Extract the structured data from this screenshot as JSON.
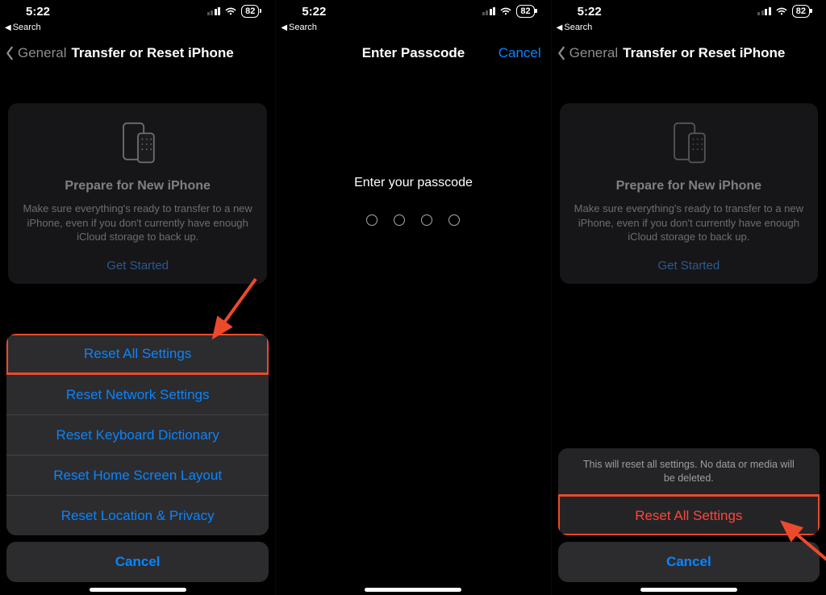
{
  "status": {
    "time": "5:22",
    "back_hint": "Search",
    "battery": "82"
  },
  "screen1": {
    "nav_back": "General",
    "nav_title": "Transfer or Reset iPhone",
    "card_title": "Prepare for New iPhone",
    "card_body": "Make sure everything's ready to transfer to a new iPhone, even if you don't currently have enough iCloud storage to back up.",
    "card_link": "Get Started",
    "sheet": {
      "items": [
        "Reset All Settings",
        "Reset Network Settings",
        "Reset Keyboard Dictionary",
        "Reset Home Screen Layout",
        "Reset Location & Privacy"
      ],
      "cancel": "Cancel"
    }
  },
  "screen2": {
    "nav_title": "Enter Passcode",
    "nav_cancel": "Cancel",
    "prompt": "Enter your passcode"
  },
  "screen3": {
    "nav_back": "General",
    "nav_title": "Transfer or Reset iPhone",
    "card_title": "Prepare for New iPhone",
    "card_body": "Make sure everything's ready to transfer to a new iPhone, even if you don't currently have enough iCloud storage to back up.",
    "card_link": "Get Started",
    "confirm_msg": "This will reset all settings. No data or media will be deleted.",
    "confirm_action": "Reset All Settings",
    "confirm_cancel": "Cancel"
  }
}
